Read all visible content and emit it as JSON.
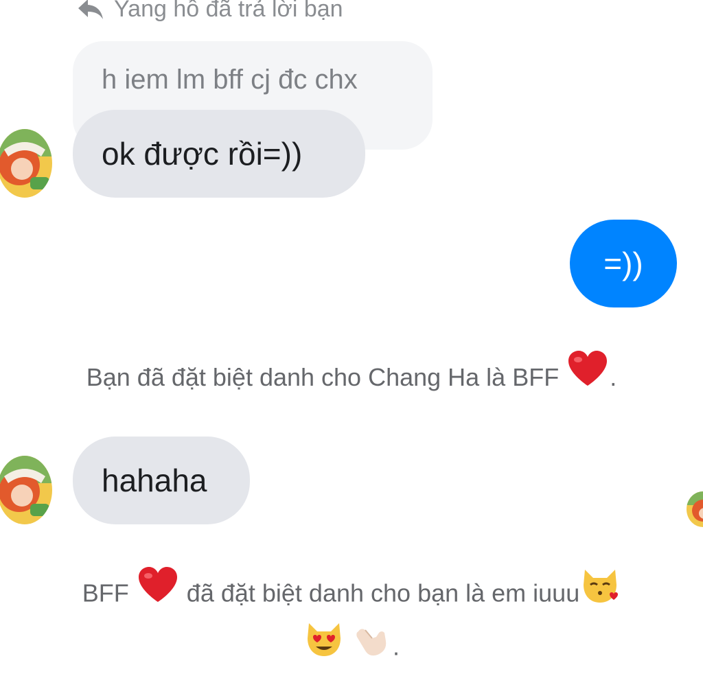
{
  "reply": {
    "header": "Yang hồ đã trả lời bạn",
    "quoted_text": "h iem lm bff cj đc chx"
  },
  "messages": {
    "incoming_1": "ok được rồi=))",
    "outgoing_1": "=))",
    "incoming_2": "hahaha"
  },
  "system": {
    "nickname_1_text": "Bạn đã đặt biệt danh cho Chang Ha là BFF",
    "nickname_1_end": ".",
    "nickname_2_prefix": "BFF",
    "nickname_2_text": "đã đặt biệt danh cho bạn là em iuuu",
    "nickname_2_end": "."
  },
  "icons": {
    "reply": "reply-arrow-icon",
    "heart": "red-heart-emoji",
    "cat_kiss": "kissing-cat-emoji",
    "cat_heart_eyes": "heart-eyes-cat-emoji",
    "call_me_hand": "call-me-hand-emoji"
  },
  "colors": {
    "outgoing_bubble": "#0084ff",
    "incoming_bubble": "#e4e6eb",
    "quoted_bubble": "#f4f5f7",
    "system_text": "#65676b",
    "heart": "#e0202b"
  }
}
